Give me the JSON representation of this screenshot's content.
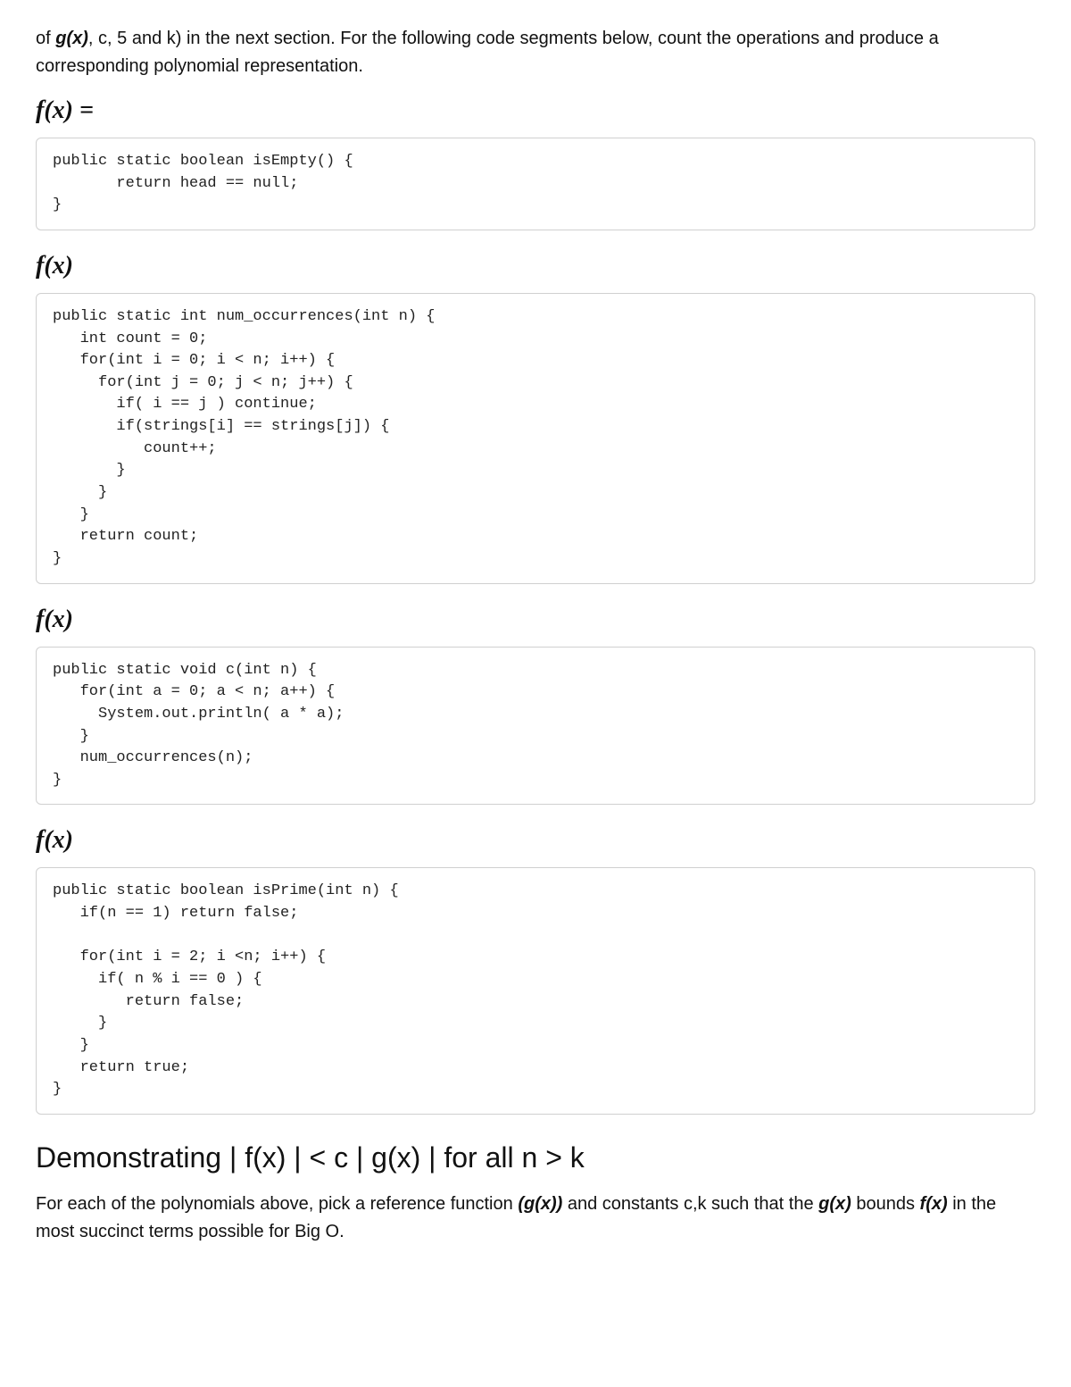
{
  "intro_parts": {
    "p1": "of ",
    "gx": "g(x)",
    "p2": ", c, 5 and k) in the next section. For the following code segments below, count the operations and produce a corresponding polynomial representation."
  },
  "fx_equals": "f(x) =",
  "fx": "f(x)",
  "code1": "public static boolean isEmpty() {\n       return head == null;\n}",
  "code2": "public static int num_occurrences(int n) {\n   int count = 0;\n   for(int i = 0; i < n; i++) {\n     for(int j = 0; j < n; j++) {\n       if( i == j ) continue;\n       if(strings[i] == strings[j]) {\n          count++;\n       }\n     }\n   }\n   return count;\n}",
  "code3": "public static void c(int n) {\n   for(int a = 0; a < n; a++) {\n     System.out.println( a * a);\n   }\n   num_occurrences(n);\n}",
  "code4": "public static boolean isPrime(int n) {\n   if(n == 1) return false;\n\n   for(int i = 2; i <n; i++) {\n     if( n % i == 0 ) {\n        return false;\n     }\n   }\n   return true;\n}",
  "section_heading": "Demonstrating | f(x) | < c | g(x) | for all n > k",
  "outro_parts": {
    "p1": "For each of the polynomials above, pick a reference function ",
    "gx_paren": "(g(x))",
    "p2": " and constants c,k such that the ",
    "gx2": "g(x)",
    "p3": " bounds ",
    "fx": "f(x)",
    "p4": " in the most succinct terms possible for Big O."
  }
}
